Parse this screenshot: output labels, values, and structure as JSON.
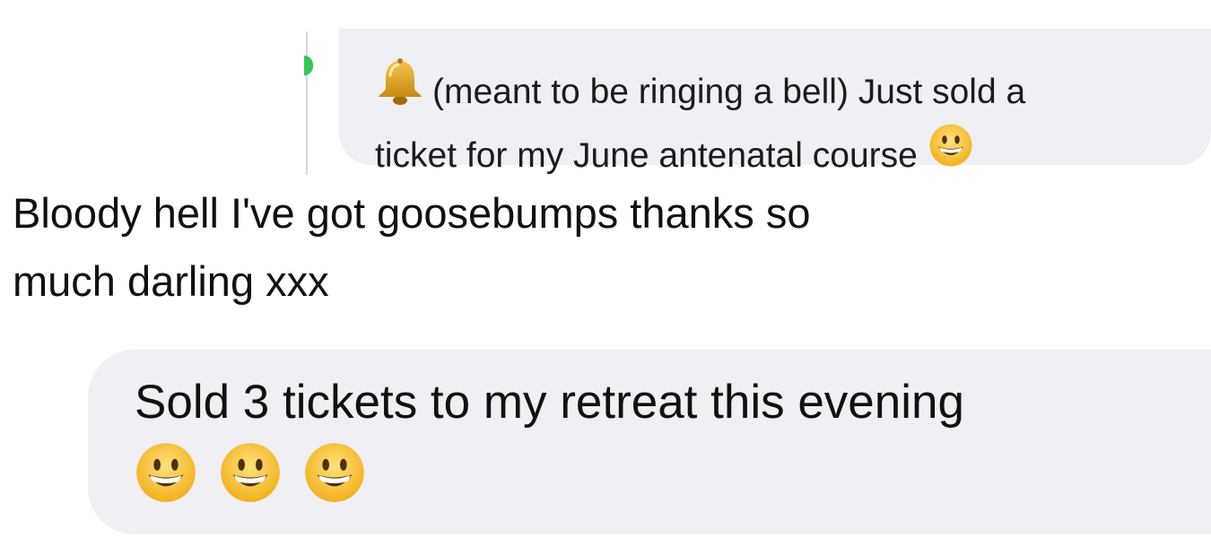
{
  "quoted_message": {
    "line1": "(meant to be ringing a bell) Just sold a",
    "line2": "ticket for my June antenatal course",
    "leading_icon": "bell-icon",
    "trailing_icon": "grinning-smiley-icon"
  },
  "reply_message": {
    "line1": "Bloody hell I've got goosebumps thanks so",
    "line2": "much darling xxx"
  },
  "main_message": {
    "line1": "Sold 3 tickets to my retreat this evening",
    "emoji": [
      "grinning-smiley-icon",
      "grinning-smiley-icon",
      "grinning-smiley-icon"
    ]
  },
  "colors": {
    "bubble_bg": "#efeff4",
    "thread_accent": "#34c759",
    "emoji_yellow": "#f7c33a"
  }
}
